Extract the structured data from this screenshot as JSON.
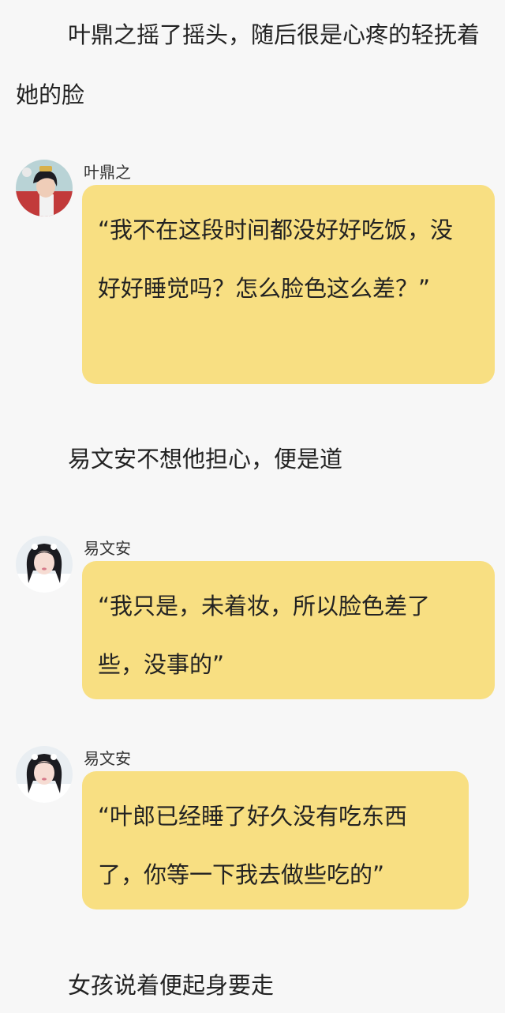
{
  "paragraphs": {
    "p1": "叶鼎之摇了摇头，随后很是心疼的轻抚着她的脸",
    "p2": "易文安不想他担心，便是道",
    "p3": "女孩说着便起身要走"
  },
  "messages": [
    {
      "speaker": "叶鼎之",
      "text": "“我不在这段时间都没好好吃饭，没好好睡觉吗？怎么脸色这么差？”",
      "avatar_icon": "male-avatar-icon"
    },
    {
      "speaker": "易文安",
      "text": "“我只是，未着妆，所以脸色差了些，没事的”",
      "avatar_icon": "female-avatar-icon"
    },
    {
      "speaker": "易文安",
      "text": "“叶郎已经睡了好久没有吃东西了，你等一下我去做些吃的”",
      "avatar_icon": "female-avatar-icon"
    }
  ],
  "colors": {
    "background": "#f7f7f7",
    "bubble": "#f8df82",
    "text": "#222222"
  }
}
